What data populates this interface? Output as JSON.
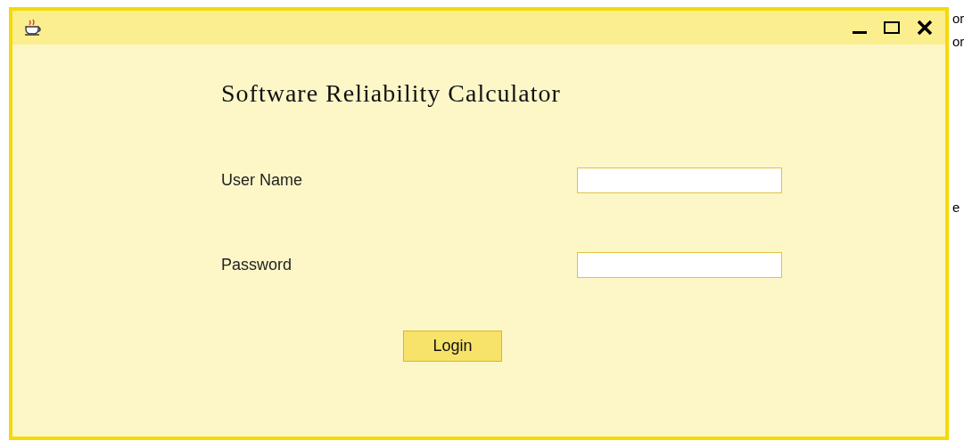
{
  "heading": "Software Reliability Calculator",
  "fields": [
    {
      "label": "User Name"
    },
    {
      "label": "Password"
    }
  ],
  "buttons": [
    "Login"
  ],
  "background_text": [
    "or",
    "or",
    "e"
  ]
}
